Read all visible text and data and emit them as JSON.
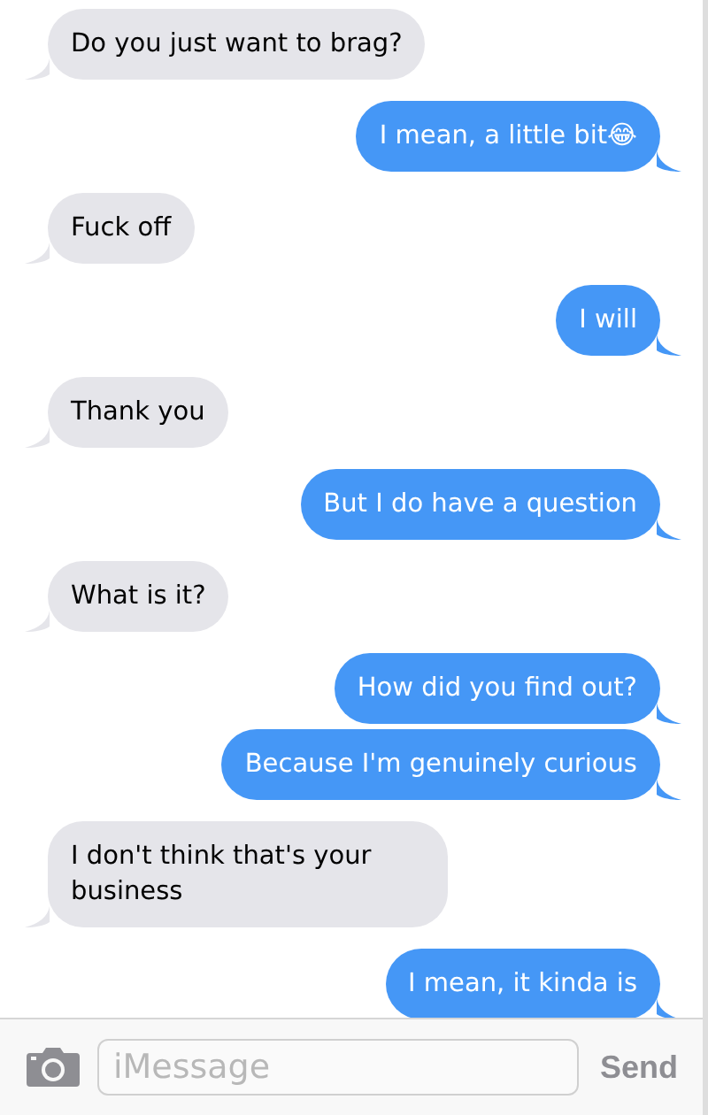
{
  "messages": [
    {
      "kind": "received",
      "text": "Do you just want to brag?"
    },
    {
      "kind": "sent",
      "text": "I mean, a little bit😂"
    },
    {
      "kind": "received",
      "text": "Fuck off"
    },
    {
      "kind": "sent",
      "text": "I will"
    },
    {
      "kind": "received",
      "text": "Thank you"
    },
    {
      "kind": "sent",
      "text": "But I do have a question"
    },
    {
      "kind": "received",
      "text": "What is it?"
    },
    {
      "kind": "sent",
      "text": "How did you find out?"
    },
    {
      "kind": "sent",
      "text": "Because I'm genuinely curious"
    },
    {
      "kind": "received",
      "text": "I don't think that's your business"
    },
    {
      "kind": "sent",
      "text": "I mean, it kinda is"
    }
  ],
  "composer": {
    "placeholder": "iMessage",
    "send_label": "Send"
  }
}
